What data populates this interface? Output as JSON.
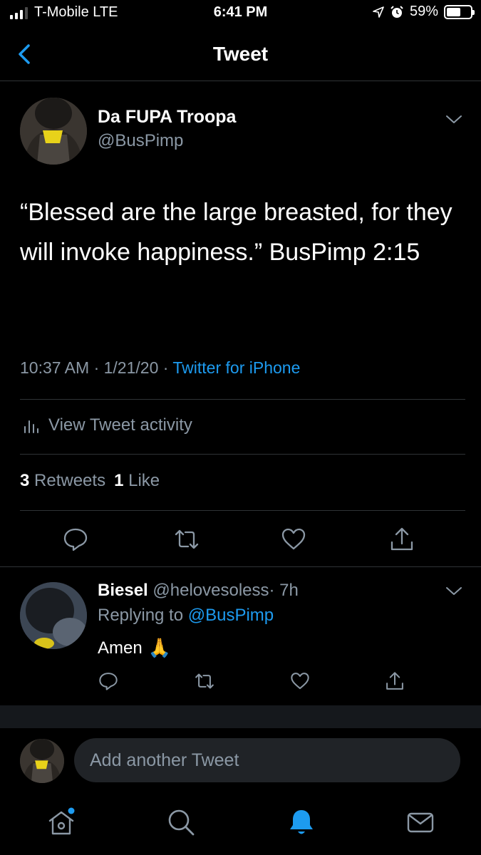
{
  "status_bar": {
    "carrier": "T-Mobile  LTE",
    "time": "6:41 PM",
    "battery_percent": "59%",
    "battery_level": 0.59
  },
  "nav": {
    "title": "Tweet",
    "back_icon": "chevron-left-icon"
  },
  "tweet": {
    "author_name": "Da FUPA Troopa",
    "author_handle": "@BusPimp",
    "text": "“Blessed are the large breasted, for they will invoke happiness.” BusPimp 2:15",
    "time": "10:37 AM · 1/21/20 · ",
    "source": "Twitter for iPhone",
    "activity_label": "View Tweet activity",
    "retweet_count": "3",
    "retweet_label": "Retweets",
    "like_count": "1",
    "like_label": "Like",
    "actions": [
      "reply-icon",
      "retweet-icon",
      "like-icon",
      "share-icon"
    ]
  },
  "reply": {
    "author_name": "Biesel",
    "author_handle": "@helovesoless",
    "age": "· 7h",
    "replying_prefix": "Replying to ",
    "replying_to": "@BusPimp",
    "text": "Amen",
    "emoji": "🙏"
  },
  "compose": {
    "placeholder": "Add another Tweet"
  },
  "tab_bar": {
    "items": [
      "home-icon",
      "search-icon",
      "notifications-icon",
      "messages-icon"
    ],
    "active": "notifications-icon"
  },
  "colors": {
    "accent": "#1d9bf0",
    "muted": "#8b98a5",
    "divider": "#2f3336",
    "background": "#000000"
  }
}
